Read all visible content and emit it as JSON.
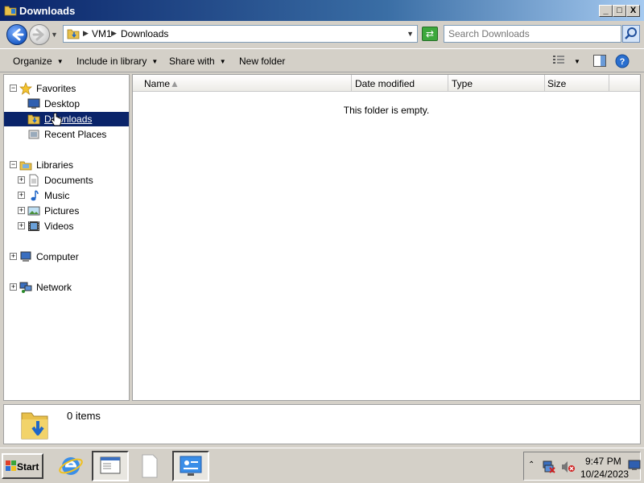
{
  "window": {
    "title": "Downloads",
    "min_label": "_",
    "max_label": "□",
    "close_label": "X"
  },
  "address": {
    "crumbs": [
      "VM1",
      "Downloads"
    ],
    "search_placeholder": "Search Downloads"
  },
  "toolbar": {
    "organize": "Organize",
    "include_in_library": "Include in library",
    "share_with": "Share with",
    "new_folder": "New folder"
  },
  "nav": {
    "favorites": {
      "label": "Favorites",
      "items": [
        {
          "label": "Desktop",
          "icon": "desktop-icon"
        },
        {
          "label": "Downloads",
          "icon": "downloads-folder-icon",
          "selected": true
        },
        {
          "label": "Recent Places",
          "icon": "recent-places-icon"
        }
      ]
    },
    "libraries": {
      "label": "Libraries",
      "items": [
        {
          "label": "Documents",
          "icon": "documents-icon"
        },
        {
          "label": "Music",
          "icon": "music-icon"
        },
        {
          "label": "Pictures",
          "icon": "pictures-icon"
        },
        {
          "label": "Videos",
          "icon": "videos-icon"
        }
      ]
    },
    "computer": "Computer",
    "network": "Network"
  },
  "list": {
    "columns": [
      "Name",
      "Date modified",
      "Type",
      "Size"
    ],
    "empty_message": "This folder is empty."
  },
  "details": {
    "count": "0 items"
  },
  "taskbar": {
    "start": "Start",
    "time": "9:47 PM",
    "date": "10/24/2023"
  },
  "colors": {
    "title_bar": "#0a246a",
    "selection": "#0a246a",
    "window_face": "#d4d0c8"
  }
}
